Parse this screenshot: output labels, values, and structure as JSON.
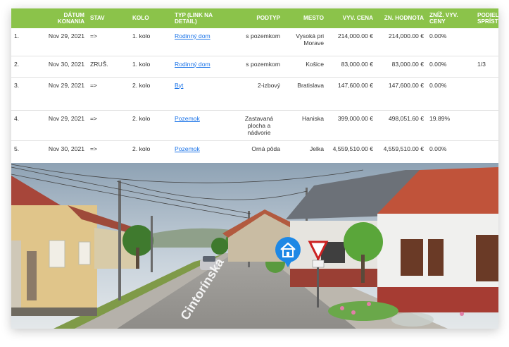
{
  "table": {
    "headers": [
      "",
      "DÁTUM KONANIA",
      "STAV",
      "KOLO",
      "TYP (LINK NA DETAIL)",
      "PODTYP",
      "MESTO",
      "VYV. CENA",
      "ZN. HODNOTA",
      "ZNÍŽ. VYV. CENY",
      "PODIEL A SPRÍSTUP."
    ],
    "rows": [
      {
        "num": "1.",
        "date": "Nov 29, 2021",
        "stav": "=>",
        "kolo": "1. kolo",
        "typ": "Rodinný dom",
        "podtyp": "s pozemkom",
        "mesto": "Vysoká pri Morave",
        "cena": "214,000.00 €",
        "hodnota": "214,000.00 €",
        "zniz": "0.00%",
        "podiel": ""
      },
      {
        "num": "2.",
        "date": "Nov 30, 2021",
        "stav": "ZRUŠ.",
        "kolo": "1. kolo",
        "typ": "Rodinný dom",
        "podtyp": "s pozemkom",
        "mesto": "Košice",
        "cena": "83,000.00 €",
        "hodnota": "83,000.00 €",
        "zniz": "0.00%",
        "podiel": "1/3"
      },
      {
        "num": "3.",
        "date": "Nov 29, 2021",
        "stav": "=>",
        "kolo": "2. kolo",
        "typ": "Byt",
        "podtyp": "2-izbový",
        "mesto": "Bratislava",
        "cena": "147,600.00 €",
        "hodnota": "147,600.00 €",
        "zniz": "0.00%",
        "podiel": ""
      },
      {
        "num": "4.",
        "date": "Nov 29, 2021",
        "stav": "=>",
        "kolo": "2. kolo",
        "typ": "Pozemok",
        "podtyp": "Zastavaná plocha a nádvorie",
        "mesto": "Haniska",
        "cena": "399,000.00 €",
        "hodnota": "498,051.60 €",
        "zniz": "19.89%",
        "podiel": ""
      },
      {
        "num": "5.",
        "date": "Nov 30, 2021",
        "stav": "=>",
        "kolo": "2. kolo",
        "typ": "Pozemok",
        "podtyp": "Orná pôda",
        "mesto": "Jelka",
        "cena": "4,559,510.00 €",
        "hodnota": "4,559,510.00 €",
        "zniz": "0.00%",
        "podiel": ""
      }
    ]
  },
  "photo": {
    "street_sign": "Cintorínska",
    "pin_icon": "house-icon",
    "colors": {
      "header_green": "#8bc34a",
      "link_blue": "#1a73e8",
      "pin_blue": "#1e88e5",
      "roof_red": "#c0533a"
    }
  }
}
